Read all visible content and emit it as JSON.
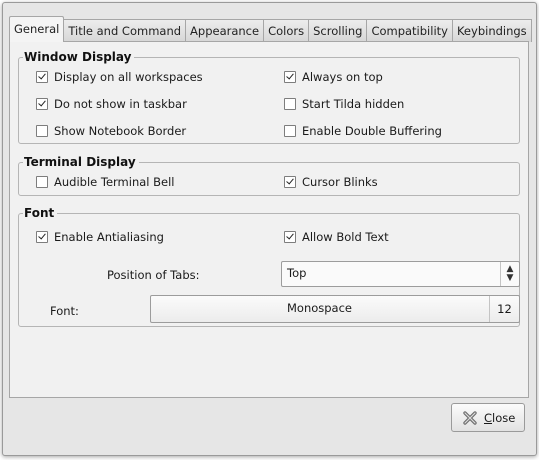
{
  "tabs": [
    {
      "label": "General",
      "active": true
    },
    {
      "label": "Title and Command"
    },
    {
      "label": "Appearance"
    },
    {
      "label": "Colors"
    },
    {
      "label": "Scrolling"
    },
    {
      "label": "Compatibility"
    },
    {
      "label": "Keybindings"
    }
  ],
  "window_display": {
    "title": "Window Display",
    "options": [
      {
        "label": "Display on all workspaces",
        "checked": true
      },
      {
        "label": "Always on top",
        "checked": true
      },
      {
        "label": "Do not show in taskbar",
        "checked": true
      },
      {
        "label": "Start Tilda hidden",
        "checked": false
      },
      {
        "label": "Show Notebook Border",
        "checked": false
      },
      {
        "label": "Enable Double Buffering",
        "checked": false
      }
    ]
  },
  "terminal_display": {
    "title": "Terminal Display",
    "options": [
      {
        "label": "Audible Terminal Bell",
        "checked": false
      },
      {
        "label": "Cursor Blinks",
        "checked": true
      }
    ]
  },
  "font_group": {
    "title": "Font",
    "options": [
      {
        "label": "Enable Antialiasing",
        "checked": true
      },
      {
        "label": "Allow Bold Text",
        "checked": true
      }
    ],
    "position_of_tabs_label": "Position of Tabs:",
    "position_of_tabs_value": "Top",
    "font_label": "Font:",
    "font_name": "Monospace",
    "font_size": "12"
  },
  "close_button": {
    "label_mnemonic": "C",
    "label_rest": "lose"
  }
}
